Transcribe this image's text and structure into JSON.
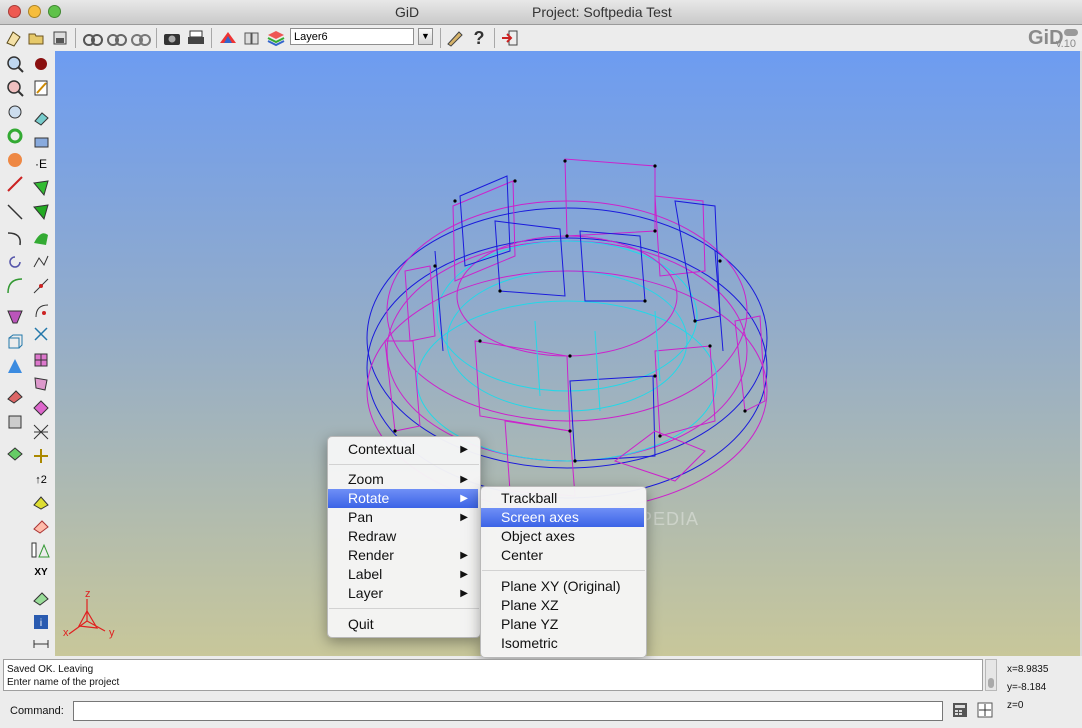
{
  "window": {
    "app_name": "GiD",
    "title": "Project: Softpedia Test"
  },
  "toolbar": {
    "layer_value": "Layer6",
    "logo_text": "GiD",
    "logo_version": "v.10"
  },
  "canvas": {
    "axis_labels": {
      "x": "x",
      "y": "y",
      "z": "z"
    },
    "watermark": "SOFTPEDIA"
  },
  "context_menu": {
    "items": [
      {
        "label": "Contextual",
        "submenu": true
      },
      {
        "label": "Zoom",
        "submenu": true
      },
      {
        "label": "Rotate",
        "submenu": true,
        "selected": true
      },
      {
        "label": "Pan",
        "submenu": true
      },
      {
        "label": "Redraw",
        "submenu": false
      },
      {
        "label": "Render",
        "submenu": true
      },
      {
        "label": "Label",
        "submenu": true
      },
      {
        "label": "Layer",
        "submenu": true
      },
      {
        "label": "Quit",
        "submenu": false
      }
    ]
  },
  "rotate_submenu": {
    "items": [
      {
        "label": "Trackball"
      },
      {
        "label": "Screen axes",
        "selected": true
      },
      {
        "label": "Object axes"
      },
      {
        "label": "Center"
      },
      {
        "label": "Plane XY (Original)"
      },
      {
        "label": "Plane XZ"
      },
      {
        "label": "Plane YZ"
      },
      {
        "label": "Isometric"
      }
    ]
  },
  "log": {
    "lines": [
      "Saved OK. Leaving",
      "Enter name of the project"
    ]
  },
  "coordinates": {
    "x": "x=8.9835",
    "y": "y=-8.184",
    "z": "z=0"
  },
  "command": {
    "label": "Command:",
    "value": ""
  },
  "colors": {
    "selection": "#3b63e6",
    "geometry_magenta": "#cc22cc",
    "geometry_blue": "#1a1adc",
    "geometry_cyan": "#22d8e8"
  }
}
